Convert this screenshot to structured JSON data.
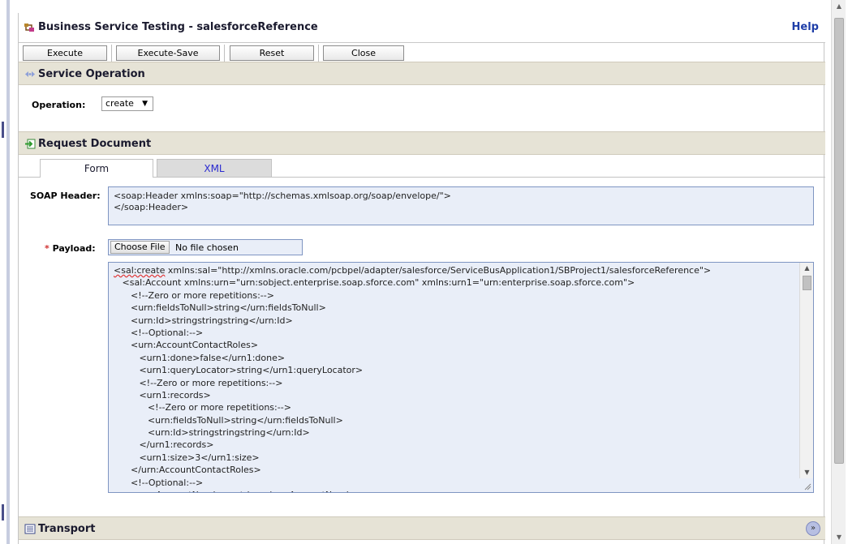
{
  "title": "Business Service Testing - salesforceReference",
  "help_label": "Help",
  "toolbar": {
    "execute": "Execute",
    "execute_save": "Execute-Save",
    "reset": "Reset",
    "close": "Close"
  },
  "service_operation": {
    "header": "Service Operation",
    "operation_label": "Operation:",
    "operation_value": "create"
  },
  "request_document": {
    "header": "Request Document",
    "tabs": [
      {
        "label": "Form"
      },
      {
        "label": "XML"
      }
    ],
    "soap_header_label": "SOAP Header:",
    "soap_header_value": "<soap:Header xmlns:soap=\"http://schemas.xmlsoap.org/soap/envelope/\">\n</soap:Header>",
    "payload_label": "Payload:",
    "payload_required_mark": "*",
    "choose_file_label": "Choose File",
    "no_file_text": "No file chosen",
    "payload_lines": [
      "<sal:create xmlns:sal=\"http://xmlns.oracle.com/pcbpel/adapter/salesforce/ServiceBusApplication1/SBProject1/salesforceReference\">",
      "   <sal:Account xmlns:urn=\"urn:sobject.enterprise.soap.sforce.com\" xmlns:urn1=\"urn:enterprise.soap.sforce.com\">",
      "      <!--Zero or more repetitions:-->",
      "      <urn:fieldsToNull>string</urn:fieldsToNull>",
      "      <urn:Id>stringstringstring</urn:Id>",
      "      <!--Optional:-->",
      "      <urn:AccountContactRoles>",
      "         <urn1:done>false</urn1:done>",
      "         <urn1:queryLocator>string</urn1:queryLocator>",
      "         <!--Zero or more repetitions:-->",
      "         <urn1:records>",
      "            <!--Zero or more repetitions:-->",
      "            <urn:fieldsToNull>string</urn:fieldsToNull>",
      "            <urn:Id>stringstringstring</urn:Id>",
      "         </urn1:records>",
      "         <urn1:size>3</urn1:size>",
      "      </urn:AccountContactRoles>",
      "      <!--Optional:-->",
      "      <urn:AccountNumber>string</urn:AccountNumber>",
      "      <!--Optional:-->"
    ]
  },
  "transport": {
    "header": "Transport"
  },
  "colors": {
    "section_header_bg": "#e6e3d6",
    "link_blue": "#1f3ea8",
    "textarea_bg": "#e9eef8",
    "required_red": "#d03030"
  },
  "icons": {
    "title": "service-testing-icon",
    "service_operation": "operation-arrows-icon",
    "request_document": "request-document-icon",
    "transport": "transport-icon",
    "expand": "double-chevron-down-icon"
  }
}
